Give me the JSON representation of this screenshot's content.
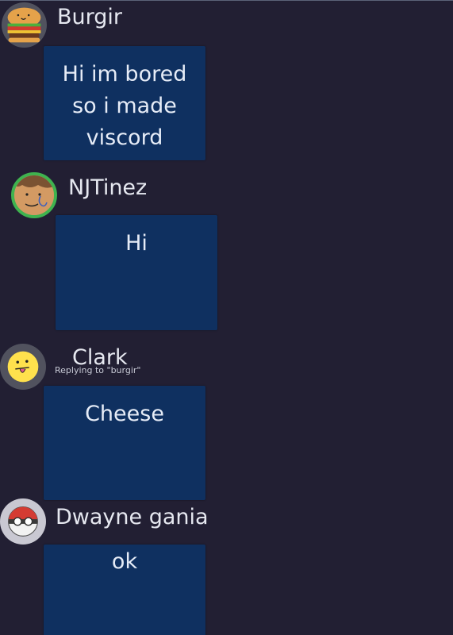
{
  "messages": [
    {
      "author": "Burgir",
      "text": [
        "Hi im bored",
        "so i made",
        "viscord"
      ],
      "reply_to": ""
    },
    {
      "author": "NJTinez",
      "text": [
        "Hi"
      ],
      "reply_to": ""
    },
    {
      "author": "Clark",
      "text": [
        "Cheese"
      ],
      "reply_to": "Replying to \"burgir\""
    },
    {
      "author": "Dwayne gania",
      "text": [
        "ok"
      ],
      "reply_to": ""
    }
  ],
  "avatars": {
    "burgir": "burger-icon",
    "njtinez": "drawn-face-icon",
    "clark": "tongue-out-emoji-icon",
    "dwayne": "pokeball-face-icon"
  },
  "colors": {
    "background": "#221f33",
    "bubble": "#0f3060",
    "text": "#e6e8f0",
    "avatar_ring_green": "#3fb34f"
  }
}
